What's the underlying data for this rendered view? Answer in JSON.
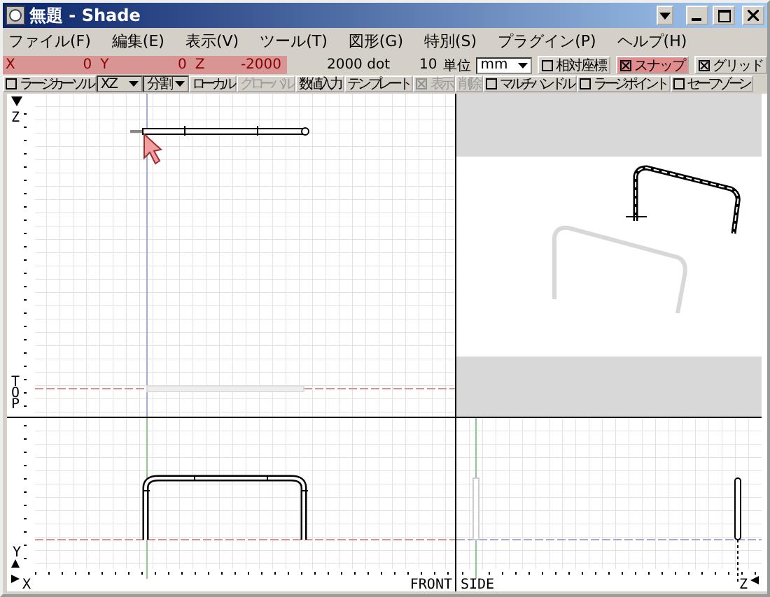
{
  "window": {
    "title": "無題 - Shade"
  },
  "menu": [
    "ファイル(F)",
    "編集(E)",
    "表示(V)",
    "ツール(T)",
    "図形(G)",
    "特別(S)",
    "プラグイン(P)",
    "ヘルプ(H)"
  ],
  "coordinate_bar": {
    "x_label": "X",
    "x_value": "0",
    "y_label": "Y",
    "y_value": "0",
    "z_label": "Z",
    "z_value": "-2000",
    "resolution": "2000 dot",
    "grid_size": "10",
    "unit_label": "単位",
    "unit": "mm",
    "toggles": [
      {
        "label": "相対座標",
        "checked": false,
        "highlighted": false
      },
      {
        "label": "スナップ",
        "checked": true,
        "highlighted": true
      },
      {
        "label": "グリッド",
        "checked": true,
        "highlighted": false
      }
    ]
  },
  "toolbar": [
    {
      "kind": "checkbox",
      "label": "ラージカーソル",
      "checked": false,
      "disabled": false
    },
    {
      "kind": "dropdown",
      "label": "XZ"
    },
    {
      "kind": "dropdown",
      "label": "分割"
    },
    {
      "kind": "button",
      "label": "ローカル",
      "disabled": false
    },
    {
      "kind": "button",
      "label": "グローバル",
      "disabled": true
    },
    {
      "kind": "button",
      "label": "数値入力",
      "disabled": false
    },
    {
      "kind": "button",
      "label": "テンプレート",
      "disabled": false
    },
    {
      "kind": "checkbox",
      "label": "表示",
      "checked": true,
      "disabled": true
    },
    {
      "kind": "button",
      "label": "削除",
      "disabled": true
    },
    {
      "kind": "checkbox",
      "label": "マルチハンドル",
      "checked": false,
      "disabled": false
    },
    {
      "kind": "checkbox",
      "label": "ラージポイント",
      "checked": false,
      "disabled": false
    },
    {
      "kind": "checkbox",
      "label": "セーフゾーン",
      "checked": false,
      "disabled": false
    }
  ],
  "views": {
    "top": {
      "axis_label": "Z",
      "view_label": "TOP"
    },
    "front": {
      "vertical_axis_label": "Y",
      "horizontal_axis_label": "X",
      "view_label": "FRONT"
    },
    "side": {
      "view_label": "SIDE",
      "horizontal_axis_label": "Z"
    }
  }
}
